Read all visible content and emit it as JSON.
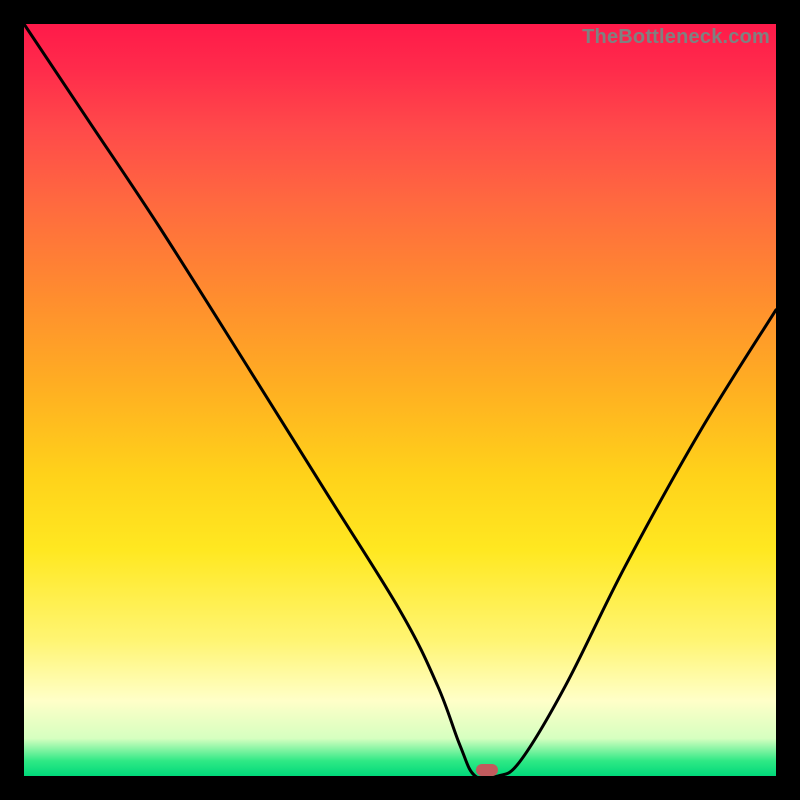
{
  "watermark": "TheBottleneck.com",
  "colors": {
    "frame": "#000000",
    "marker": "#c15a5d",
    "curve": "#000000"
  },
  "chart_data": {
    "type": "line",
    "title": "",
    "xlabel": "",
    "ylabel": "",
    "xlim": [
      0,
      100
    ],
    "ylim": [
      0,
      100
    ],
    "grid": false,
    "series": [
      {
        "name": "bottleneck-curve",
        "x": [
          0,
          8,
          18,
          30,
          40,
          50,
          55,
          58,
          60,
          63,
          66,
          72,
          80,
          90,
          100
        ],
        "values": [
          100,
          88,
          73,
          54,
          38,
          22,
          12,
          4,
          0,
          0,
          2,
          12,
          28,
          46,
          62
        ]
      }
    ],
    "annotations": [
      {
        "name": "marker",
        "x": 61.5,
        "y": 0,
        "shape": "pill",
        "color": "#c15a5d"
      }
    ],
    "background_gradient": {
      "direction": "vertical",
      "stops": [
        {
          "pos": 0.0,
          "color": "#ff1a4a"
        },
        {
          "pos": 0.24,
          "color": "#ff6a3f"
        },
        {
          "pos": 0.48,
          "color": "#ffae22"
        },
        {
          "pos": 0.7,
          "color": "#ffe821"
        },
        {
          "pos": 0.9,
          "color": "#ffffc8"
        },
        {
          "pos": 0.98,
          "color": "#2fe985"
        },
        {
          "pos": 1.0,
          "color": "#00d87a"
        }
      ]
    }
  }
}
